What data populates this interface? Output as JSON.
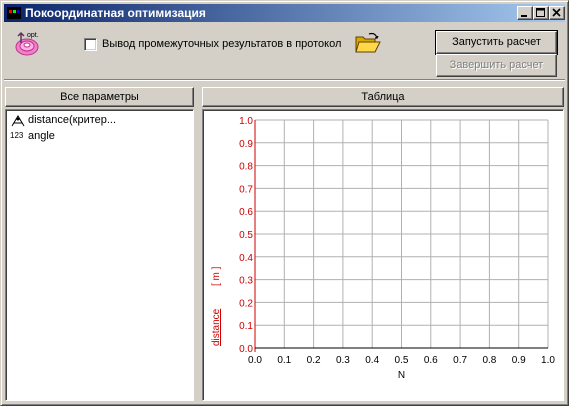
{
  "window": {
    "title": "Покоординатная оптимизация",
    "colors": {
      "titlebar_start": "#0a246a",
      "titlebar_end": "#a6caf0",
      "face": "#d4d0c8"
    },
    "controls": [
      "minimize-icon",
      "restore-icon",
      "close-icon"
    ]
  },
  "toolbar": {
    "opt_icon_label": "opt.",
    "log_checkbox": {
      "label": "Вывод промежуточных результатов в протокол",
      "checked": false
    },
    "folder_icon": "open-folder-icon",
    "run_button": "Запустить расчет",
    "stop_button": "Завершить расчет"
  },
  "left_panel": {
    "header": "Все параметры",
    "items": [
      {
        "icon": "distance-criterion-icon",
        "label": "distance(критер..."
      },
      {
        "icon": "numeric-123-icon",
        "icon_text": "123",
        "label": "angle"
      }
    ]
  },
  "right_panel": {
    "header": "Таблица"
  },
  "chart_data": {
    "type": "line",
    "xlabel": "N",
    "ylabel": "distance",
    "yunit": "[ m ]",
    "x_ticks": [
      "0.0",
      "0.1",
      "0.2",
      "0.3",
      "0.4",
      "0.5",
      "0.6",
      "0.7",
      "0.8",
      "0.9",
      "1.0"
    ],
    "y_ticks": [
      "0.0",
      "0.1",
      "0.2",
      "0.3",
      "0.4",
      "0.5",
      "0.6",
      "0.7",
      "0.8",
      "0.9",
      "1.0"
    ],
    "xlim": [
      0,
      1
    ],
    "ylim": [
      0,
      1
    ],
    "grid": true,
    "series": [],
    "colors": {
      "y_axis": "#cc0000",
      "grid": "#b0b0b0",
      "x_axis": "#000000"
    }
  }
}
